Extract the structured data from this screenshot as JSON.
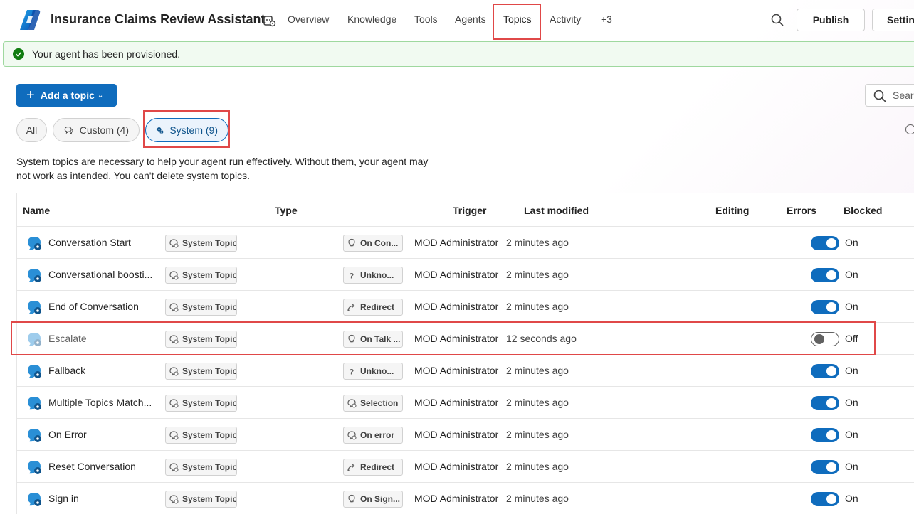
{
  "header": {
    "app_title": "Insurance Claims Review Assistant",
    "tabs": [
      {
        "label": "Overview"
      },
      {
        "label": "Knowledge"
      },
      {
        "label": "Tools"
      },
      {
        "label": "Agents"
      },
      {
        "label": "Topics",
        "active": true
      },
      {
        "label": "Activity"
      },
      {
        "label": "+3"
      }
    ],
    "publish_label": "Publish",
    "settings_label": "Settings"
  },
  "banner": {
    "message": "Your agent has been provisioned.",
    "status_color": "#107c10"
  },
  "toolbar": {
    "add_topic_label": "Add a topic",
    "search_placeholder": "Search"
  },
  "filters": [
    {
      "label": "All"
    },
    {
      "label": "Custom (4)"
    },
    {
      "label": "System (9)",
      "selected": true
    }
  ],
  "description": "System topics are necessary to help your agent run effectively. Without them, your agent may not work as intended. You can't delete system topics.",
  "table": {
    "columns": [
      "Name",
      "Type",
      "Trigger",
      "Last modified",
      "Editing",
      "Errors",
      "Blocked"
    ],
    "rows": [
      {
        "name": "Conversation Start",
        "type": "System Topic",
        "trigger": "On Con...",
        "trigger_icon": "lightbulb-icon",
        "modified_by": "MOD Administrator",
        "modified": "2 minutes ago",
        "state": "On",
        "enabled": true
      },
      {
        "name": "Conversational boosti...",
        "type": "System Topic",
        "trigger": "Unkno...",
        "trigger_icon": "question-icon",
        "modified_by": "MOD Administrator",
        "modified": "2 minutes ago",
        "state": "On",
        "enabled": true
      },
      {
        "name": "End of Conversation",
        "type": "System Topic",
        "trigger": "Redirect",
        "trigger_icon": "redirect-icon",
        "modified_by": "MOD Administrator",
        "modified": "2 minutes ago",
        "state": "On",
        "enabled": true
      },
      {
        "name": "Escalate",
        "type": "System Topic",
        "trigger": "On Talk ...",
        "trigger_icon": "lightbulb-icon",
        "modified_by": "MOD Administrator",
        "modified": "12 seconds ago",
        "state": "Off",
        "enabled": false
      },
      {
        "name": "Fallback",
        "type": "System Topic",
        "trigger": "Unkno...",
        "trigger_icon": "question-icon",
        "modified_by": "MOD Administrator",
        "modified": "2 minutes ago",
        "state": "On",
        "enabled": true
      },
      {
        "name": "Multiple Topics Match...",
        "type": "System Topic",
        "trigger": "Selection",
        "trigger_icon": "selection-icon",
        "modified_by": "MOD Administrator",
        "modified": "2 minutes ago",
        "state": "On",
        "enabled": true
      },
      {
        "name": "On Error",
        "type": "System Topic",
        "trigger": "On error",
        "trigger_icon": "error-icon",
        "modified_by": "MOD Administrator",
        "modified": "2 minutes ago",
        "state": "On",
        "enabled": true
      },
      {
        "name": "Reset Conversation",
        "type": "System Topic",
        "trigger": "Redirect",
        "trigger_icon": "redirect-icon",
        "modified_by": "MOD Administrator",
        "modified": "2 minutes ago",
        "state": "On",
        "enabled": true
      },
      {
        "name": "Sign in",
        "type": "System Topic",
        "trigger": "On Sign...",
        "trigger_icon": "lightbulb-icon",
        "modified_by": "MOD Administrator",
        "modified": "2 minutes ago",
        "state": "On",
        "enabled": true
      }
    ]
  },
  "colors": {
    "accent": "#0f6cbd",
    "highlight": "#e04848"
  }
}
